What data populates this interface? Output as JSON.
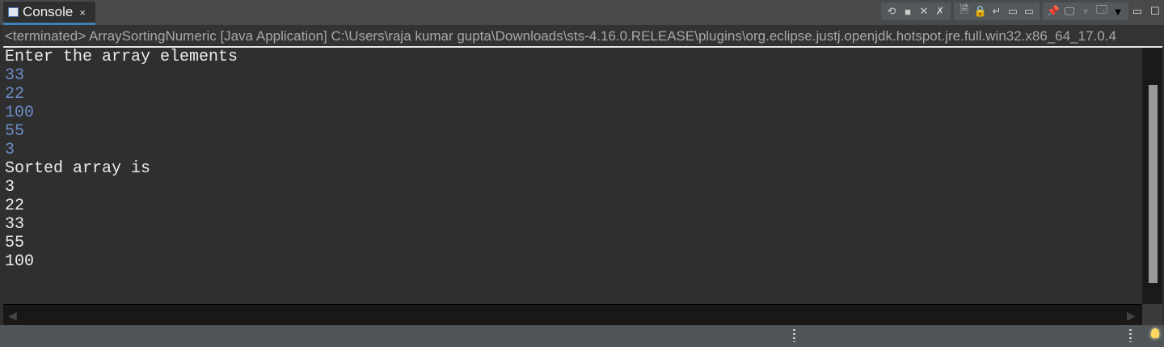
{
  "tab": {
    "label": "Console",
    "close": "×"
  },
  "status_line": "<terminated> ArraySortingNumeric [Java Application] C:\\Users\\raja kumar gupta\\Downloads\\sts-4.16.0.RELEASE\\plugins\\org.eclipse.justj.openjdk.hotspot.jre.full.win32.x86_64_17.0.4",
  "console_lines": [
    {
      "text": "Enter the array elements",
      "type": "out"
    },
    {
      "text": "33",
      "type": "in"
    },
    {
      "text": "22",
      "type": "in"
    },
    {
      "text": "100",
      "type": "in"
    },
    {
      "text": "55",
      "type": "in"
    },
    {
      "text": "3",
      "type": "in"
    },
    {
      "text": "Sorted array is",
      "type": "out"
    },
    {
      "text": "3",
      "type": "out"
    },
    {
      "text": "22",
      "type": "out"
    },
    {
      "text": "33",
      "type": "out"
    },
    {
      "text": "55",
      "type": "out"
    },
    {
      "text": "100",
      "type": "out"
    }
  ],
  "colors": {
    "input": "#6b8cc4",
    "output": "#ececec",
    "tab_accent": "#3f82b8"
  }
}
